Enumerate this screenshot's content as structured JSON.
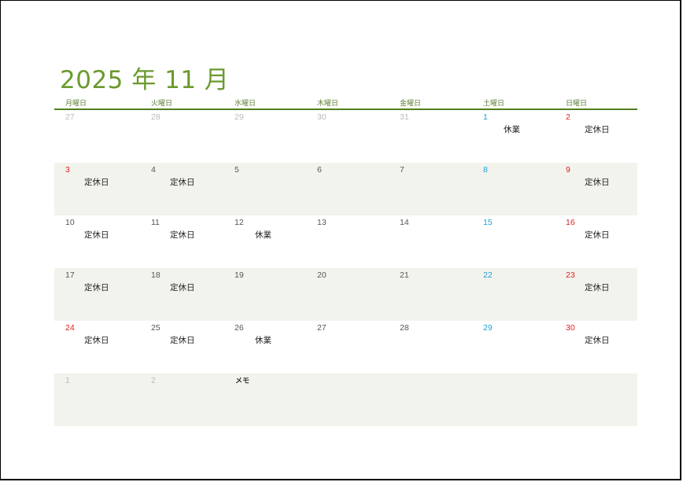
{
  "title": "2025 年 11 月",
  "weekdays": [
    "月曜日",
    "火曜日",
    "水曜日",
    "木曜日",
    "金曜日",
    "土曜日",
    "日曜日"
  ],
  "weeks": [
    [
      {
        "day": "27",
        "kind": "faded",
        "note": ""
      },
      {
        "day": "28",
        "kind": "faded",
        "note": ""
      },
      {
        "day": "29",
        "kind": "faded",
        "note": ""
      },
      {
        "day": "30",
        "kind": "faded",
        "note": ""
      },
      {
        "day": "31",
        "kind": "faded",
        "note": ""
      },
      {
        "day": "1",
        "kind": "sat",
        "note": "休業"
      },
      {
        "day": "2",
        "kind": "sun",
        "note": "定休日"
      }
    ],
    [
      {
        "day": "3",
        "kind": "sun",
        "note": "定休日"
      },
      {
        "day": "4",
        "kind": "normal",
        "note": "定休日"
      },
      {
        "day": "5",
        "kind": "normal",
        "note": ""
      },
      {
        "day": "6",
        "kind": "normal",
        "note": ""
      },
      {
        "day": "7",
        "kind": "normal",
        "note": ""
      },
      {
        "day": "8",
        "kind": "sat",
        "note": ""
      },
      {
        "day": "9",
        "kind": "sun",
        "note": "定休日"
      }
    ],
    [
      {
        "day": "10",
        "kind": "normal",
        "note": "定休日"
      },
      {
        "day": "11",
        "kind": "normal",
        "note": "定休日"
      },
      {
        "day": "12",
        "kind": "normal",
        "note": "休業"
      },
      {
        "day": "13",
        "kind": "normal",
        "note": ""
      },
      {
        "day": "14",
        "kind": "normal",
        "note": ""
      },
      {
        "day": "15",
        "kind": "sat",
        "note": ""
      },
      {
        "day": "16",
        "kind": "sun",
        "note": "定休日"
      }
    ],
    [
      {
        "day": "17",
        "kind": "normal",
        "note": "定休日"
      },
      {
        "day": "18",
        "kind": "normal",
        "note": "定休日"
      },
      {
        "day": "19",
        "kind": "normal",
        "note": ""
      },
      {
        "day": "20",
        "kind": "normal",
        "note": ""
      },
      {
        "day": "21",
        "kind": "normal",
        "note": ""
      },
      {
        "day": "22",
        "kind": "sat",
        "note": ""
      },
      {
        "day": "23",
        "kind": "sun",
        "note": "定休日"
      }
    ],
    [
      {
        "day": "24",
        "kind": "sun",
        "note": "定休日"
      },
      {
        "day": "25",
        "kind": "normal",
        "note": "定休日"
      },
      {
        "day": "26",
        "kind": "normal",
        "note": "休業"
      },
      {
        "day": "27",
        "kind": "normal",
        "note": ""
      },
      {
        "day": "28",
        "kind": "normal",
        "note": ""
      },
      {
        "day": "29",
        "kind": "sat",
        "note": ""
      },
      {
        "day": "30",
        "kind": "sun",
        "note": "定休日"
      }
    ]
  ],
  "next_month_days": [
    "1",
    "2"
  ],
  "memo_label": "メモ",
  "colors": {
    "title": "#6a9a2e",
    "header_rule": "#4f7f1e",
    "sunday": "#e02020",
    "saturday": "#1f9fd8",
    "shaded_row": "#f3f3ee"
  }
}
